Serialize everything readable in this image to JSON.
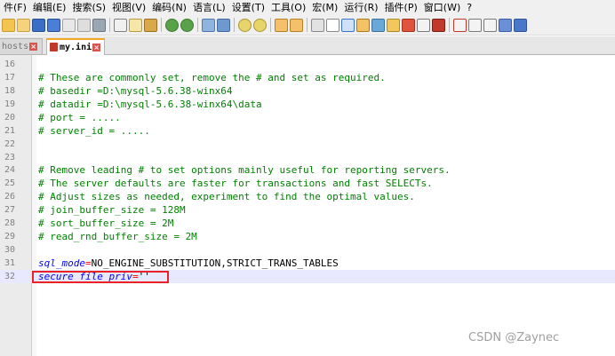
{
  "menu": {
    "items": [
      "件(F)",
      "编辑(E)",
      "搜索(S)",
      "视图(V)",
      "编码(N)",
      "语言(L)",
      "设置(T)",
      "工具(O)",
      "宏(M)",
      "运行(R)",
      "插件(P)",
      "窗口(W)",
      "?"
    ]
  },
  "toolbar": {
    "icons": [
      "new-file-icon",
      "open-icon",
      "save-icon",
      "save-all-icon",
      "close-icon",
      "close-all-icon",
      "print-icon",
      "cut-icon",
      "copy-icon",
      "paste-icon",
      "undo-icon",
      "redo-icon",
      "find-icon",
      "replace-icon",
      "zoom-in-icon",
      "zoom-out-icon",
      "sync-v-icon",
      "sync-h-icon",
      "word-wrap-icon",
      "show-all-chars-icon",
      "indent-guide-icon",
      "doc-map-icon",
      "function-list-icon",
      "folder-workspace-icon",
      "monitoring-icon",
      "record-macro-icon",
      "stop-macro-icon",
      "play-macro-icon",
      "play-multiple-icon",
      "save-macro-icon"
    ]
  },
  "tabs": [
    {
      "label": "hosts",
      "active": false
    },
    {
      "label": "my.ini",
      "active": true
    }
  ],
  "editor": {
    "lines": [
      {
        "num": "16",
        "text": ""
      },
      {
        "num": "17",
        "text": "# These are commonly set, remove the # and set as required."
      },
      {
        "num": "18",
        "text": "# basedir =D:\\mysql-5.6.38-winx64"
      },
      {
        "num": "19",
        "text": "# datadir =D:\\mysql-5.6.38-winx64\\data"
      },
      {
        "num": "20",
        "text": "# port = ....."
      },
      {
        "num": "21",
        "text": "# server_id = ....."
      },
      {
        "num": "22",
        "text": ""
      },
      {
        "num": "23",
        "text": ""
      },
      {
        "num": "24",
        "text": "# Remove leading # to set options mainly useful for reporting servers."
      },
      {
        "num": "25",
        "text": "# The server defaults are faster for transactions and fast SELECTs."
      },
      {
        "num": "26",
        "text": "# Adjust sizes as needed, experiment to find the optimal values."
      },
      {
        "num": "27",
        "text": "# join_buffer_size = 128M"
      },
      {
        "num": "28",
        "text": "# sort_buffer_size = 2M"
      },
      {
        "num": "29",
        "text": "# read_rnd_buffer_size = 2M"
      },
      {
        "num": "30",
        "text": ""
      },
      {
        "num": "31",
        "key": "sql_mode",
        "eq": "=",
        "value": "NO_ENGINE_SUBSTITUTION,STRICT_TRANS_TABLES"
      },
      {
        "num": "32",
        "key": "secure_file_priv",
        "eq": "=",
        "value": "''"
      }
    ]
  },
  "watermark": "CSDN @Zaynec",
  "colors": {
    "comment": "#008000",
    "key": "#0000ff",
    "equals": "#ff0000",
    "highlight_box": "#e8232a",
    "active_tab_accent": "#f5a623"
  }
}
